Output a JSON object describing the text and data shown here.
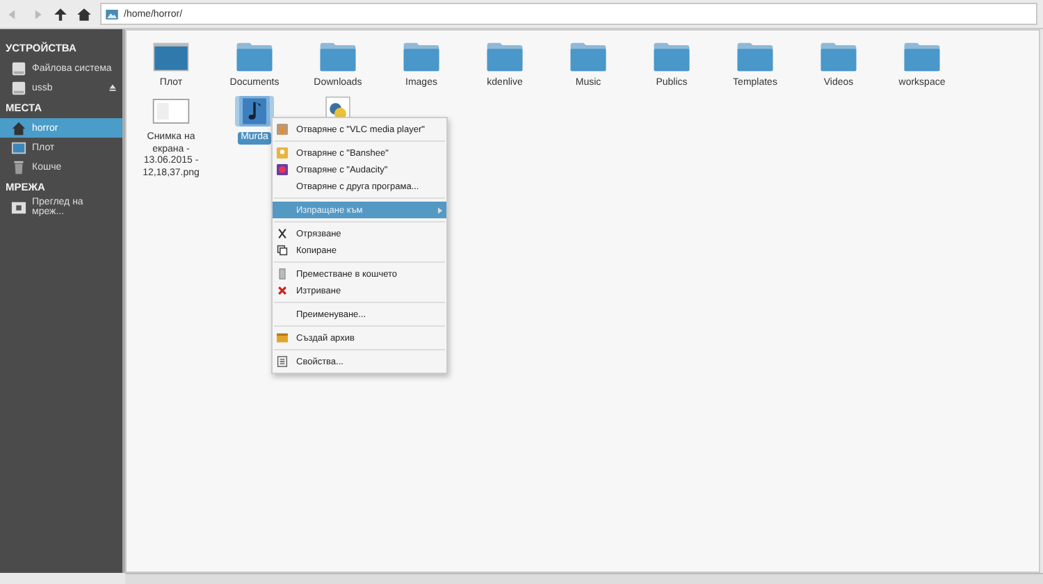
{
  "toolbar": {
    "path": "/home/horror/"
  },
  "sidebar": [
    {
      "heading": "УСТРОЙСТВА",
      "items": [
        {
          "label": "Файлова система",
          "kind": "drive",
          "selected": false,
          "eject": false
        },
        {
          "label": "ussb",
          "kind": "drive",
          "selected": false,
          "eject": true
        }
      ]
    },
    {
      "heading": "МЕСТА",
      "items": [
        {
          "label": "horror",
          "kind": "home",
          "selected": true,
          "eject": false
        },
        {
          "label": "Плот",
          "kind": "desktop",
          "selected": false,
          "eject": false
        },
        {
          "label": "Кошче",
          "kind": "trash",
          "selected": false,
          "eject": false
        }
      ]
    },
    {
      "heading": "МРЕЖА",
      "items": [
        {
          "label": "Преглед на мреж...",
          "kind": "network",
          "selected": false,
          "eject": false
        }
      ]
    }
  ],
  "files": [
    {
      "label": "Плот",
      "kind": "desktop",
      "selected": false
    },
    {
      "label": "Documents",
      "kind": "folder",
      "selected": false
    },
    {
      "label": "Downloads",
      "kind": "folder",
      "selected": false
    },
    {
      "label": "Images",
      "kind": "folder",
      "selected": false
    },
    {
      "label": "kdenlive",
      "kind": "folder",
      "selected": false
    },
    {
      "label": "Music",
      "kind": "folder",
      "selected": false
    },
    {
      "label": "Publics",
      "kind": "folder",
      "selected": false
    },
    {
      "label": "Templates",
      "kind": "folder",
      "selected": false
    },
    {
      "label": "Videos",
      "kind": "folder",
      "selected": false
    },
    {
      "label": "workspace",
      "kind": "folder",
      "selected": false
    },
    {
      "label": "Снимка на екрана - 13.06.2015 - 12,18,37.png",
      "kind": "image",
      "selected": false
    },
    {
      "label": "Murda",
      "kind": "audio",
      "selected": true
    },
    {
      "kind": "script",
      "selected": false
    }
  ],
  "context_menu": [
    [
      {
        "label": "Отваряне с \"VLC media player\"",
        "selected": false
      }
    ],
    [
      {
        "label": "Отваряне с \"Banshee\"",
        "selected": false
      },
      {
        "label": "Отваряне с \"Audacity\"",
        "selected": false
      },
      {
        "label": "Отваряне с друга програма...",
        "selected": false
      }
    ],
    [
      {
        "label": "Изпращане към",
        "kind": "submenu",
        "selected": true
      }
    ],
    [
      {
        "label": "Отрязване",
        "selected": false
      },
      {
        "label": "Копиране",
        "selected": false
      }
    ],
    [
      {
        "label": "Преместване в кошчето",
        "selected": false
      },
      {
        "label": "Изтриване",
        "selected": false
      }
    ],
    [
      {
        "label": "Преименуване...",
        "selected": false
      }
    ],
    [
      {
        "label": "Създай архив",
        "selected": false
      }
    ],
    [
      {
        "label": "Свойства...",
        "selected": false
      }
    ]
  ]
}
